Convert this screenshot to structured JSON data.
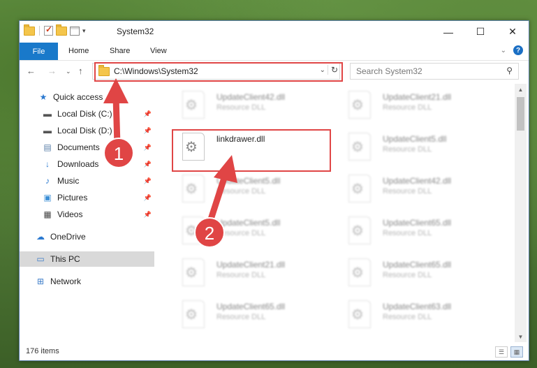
{
  "window": {
    "title": "System32",
    "controls": {
      "minimize": "—",
      "maximize": "☐",
      "close": "✕"
    }
  },
  "ribbon": {
    "tabs": [
      "File",
      "Home",
      "Share",
      "View"
    ],
    "help": "?"
  },
  "address": {
    "path": "C:\\Windows\\System32",
    "search_placeholder": "Search System32"
  },
  "sidebar": {
    "items": [
      {
        "label": "Quick access",
        "icon": "star-icon"
      },
      {
        "label": "Local Disk (C:)",
        "icon": "drive-icon",
        "pinned": true
      },
      {
        "label": "Local Disk (D:)",
        "icon": "drive-icon",
        "pinned": true
      },
      {
        "label": "Documents",
        "icon": "documents-icon",
        "pinned": true
      },
      {
        "label": "Downloads",
        "icon": "download-icon",
        "pinned": true
      },
      {
        "label": "Music",
        "icon": "music-icon",
        "pinned": true
      },
      {
        "label": "Pictures",
        "icon": "pictures-icon",
        "pinned": true
      },
      {
        "label": "Videos",
        "icon": "video-icon",
        "pinned": true
      },
      {
        "label": "OneDrive",
        "icon": "cloud-icon"
      },
      {
        "label": "This PC",
        "icon": "computer-icon",
        "selected": true
      },
      {
        "label": "Network",
        "icon": "network-icon"
      }
    ]
  },
  "files": [
    {
      "name": "UpdateClient42.dll",
      "type": "Resource DLL"
    },
    {
      "name": "UpdateClient21.dll",
      "type": "Resource DLL"
    },
    {
      "name": "linkdrawer.dll",
      "type": ""
    },
    {
      "name": "UpdateClient5.dll",
      "type": "Resource DLL"
    },
    {
      "name": "UpdateClient5.dll",
      "type": "Resource DLL"
    },
    {
      "name": "UpdateClient42.dll",
      "type": "Resource DLL"
    },
    {
      "name": "UpdateClient5.dll",
      "type": "Resource DLL"
    },
    {
      "name": "UpdateClient65.dll",
      "type": "Resource DLL"
    },
    {
      "name": "UpdateClient21.dll",
      "type": "Resource DLL"
    },
    {
      "name": "UpdateClient65.dll",
      "type": "Resource DLL"
    },
    {
      "name": "UpdateClient65.dll",
      "type": "Resource DLL"
    },
    {
      "name": "UpdateClient63.dll",
      "type": "Resource DLL"
    }
  ],
  "status": {
    "item_count": "176 items"
  },
  "annotations": {
    "badge1": "1",
    "badge2": "2",
    "color": "#e04545"
  }
}
